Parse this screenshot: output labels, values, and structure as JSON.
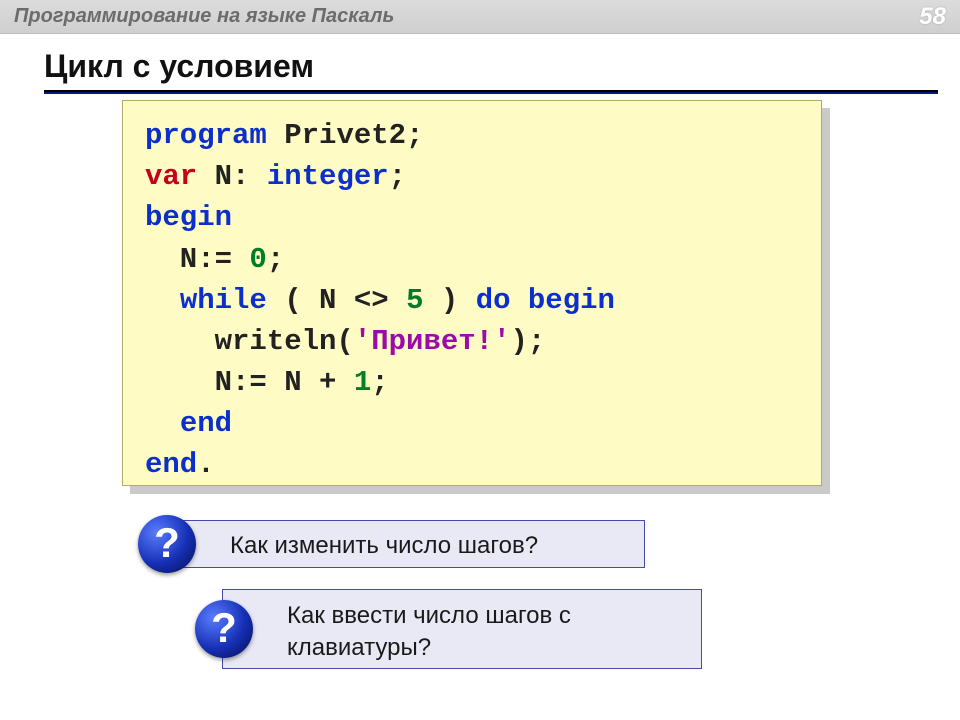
{
  "header": {
    "course": "Программирование на языке Паскаль",
    "page": "58"
  },
  "title": "Цикл с условием",
  "code": {
    "l1_kw": "program",
    "l1_rest": " Privet2;",
    "l2_var": "var",
    "l2_decl": " N: ",
    "l2_type": "integer",
    "l2_end": ";",
    "l3": "begin",
    "l4_pre": "  N:= ",
    "l4_num": "0",
    "l4_post": ";",
    "l5_a": "  ",
    "l5_while": "while",
    "l5_b": " ( N <> ",
    "l5_num": "5",
    "l5_c": " ) ",
    "l5_do": "do",
    "l5_d": " ",
    "l5_begin": "begin",
    "l6_pre": "    writeln(",
    "l6_q1": "'",
    "l6_str": "Привет!",
    "l6_q2": "'",
    "l6_post": ");",
    "l7_pre": "    N:= N + ",
    "l7_num": "1",
    "l7_post": ";",
    "l8_pre": "  ",
    "l8": "end",
    "l9": "end",
    "l9_post": "."
  },
  "questions": {
    "icon": "?",
    "q1": "Как изменить число шагов?",
    "q2": "Как ввести число шагов с клавиатуры?"
  }
}
